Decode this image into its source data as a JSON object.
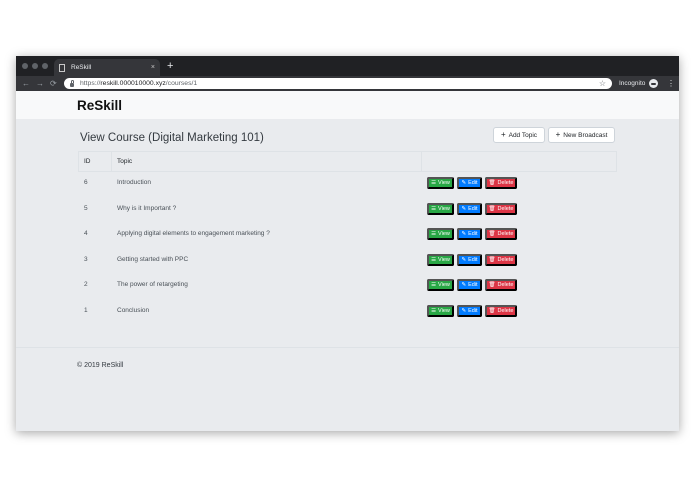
{
  "browser": {
    "tab_title": "ReSkill",
    "tab_close": "×",
    "new_tab": "+",
    "back": "←",
    "forward": "→",
    "reload": "⟳",
    "url_scheme": "https://",
    "url_host": "reskill.000010000.xyz",
    "url_path": "/courses/1",
    "bookmark_star": "☆",
    "incognito_label": "Incognito",
    "menu": "⋮"
  },
  "navbar": {
    "brand": "ReSkill"
  },
  "page": {
    "title": "View Course (Digital Marketing 101)",
    "add_topic_label": "Add Topic",
    "new_broadcast_label": "New Broadcast",
    "plus_icon": "+"
  },
  "table": {
    "columns": [
      "ID",
      "Topic"
    ],
    "rows": [
      {
        "id": "6",
        "topic": "Introduction"
      },
      {
        "id": "5",
        "topic": "Why is it Important ?"
      },
      {
        "id": "4",
        "topic": "Applying digital elements to engagement marketing ?"
      },
      {
        "id": "3",
        "topic": "Getting started with PPC"
      },
      {
        "id": "2",
        "topic": "The power of retargeting"
      },
      {
        "id": "1",
        "topic": "Conclusion"
      }
    ],
    "actions": {
      "view_label": "View",
      "edit_label": "Edit",
      "delete_label": "Delete",
      "view_icon": "☰",
      "edit_icon": "✎",
      "delete_icon": "🗑"
    }
  },
  "footer": {
    "copyright": "© 2019 ReSkill"
  },
  "colors": {
    "view": "#28a745",
    "edit": "#007bff",
    "delete": "#dc3545",
    "page_bg": "#e9ebee",
    "navbar_bg": "#f8f9fa",
    "browser_chrome": "#202124"
  }
}
